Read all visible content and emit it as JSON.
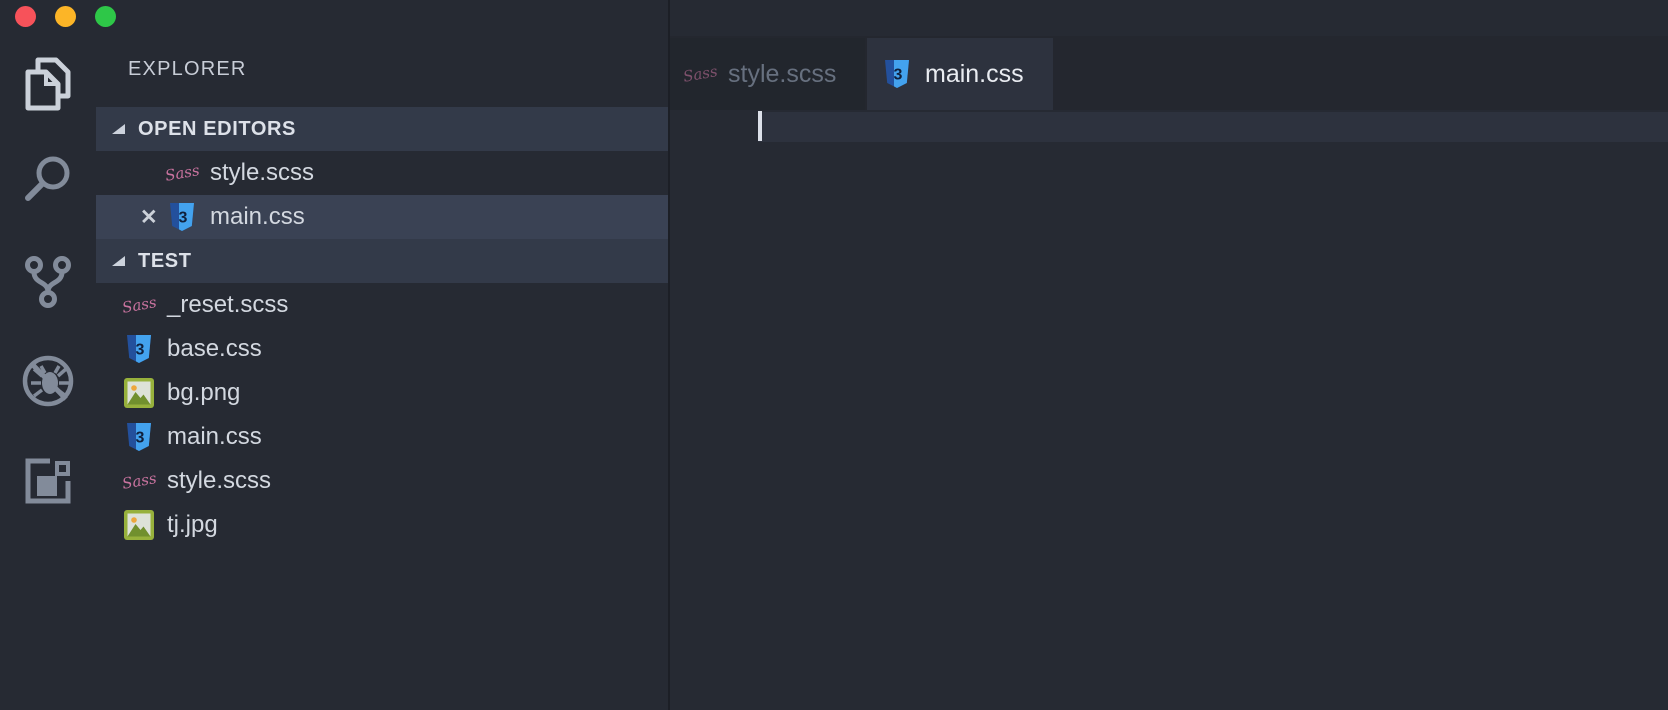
{
  "window": {
    "traffic_lights": [
      {
        "name": "close",
        "color": "#f7525a"
      },
      {
        "name": "minimize",
        "color": "#fcb527"
      },
      {
        "name": "zoom",
        "color": "#2ec748"
      }
    ]
  },
  "activity_bar": {
    "items": [
      {
        "id": "explorer",
        "icon": "files-icon",
        "active": true
      },
      {
        "id": "search",
        "icon": "search-icon",
        "active": false
      },
      {
        "id": "source-control",
        "icon": "git-branch-icon",
        "active": false
      },
      {
        "id": "debug",
        "icon": "debug-disabled-icon",
        "active": false
      },
      {
        "id": "extensions",
        "icon": "extensions-icon",
        "active": false
      }
    ]
  },
  "sidebar": {
    "title": "EXPLORER",
    "sections": [
      {
        "id": "open-editors",
        "header": "OPEN EDITORS",
        "expanded": true
      },
      {
        "id": "test",
        "header": "TEST",
        "expanded": true
      }
    ],
    "open_editors": [
      {
        "name": "style.scss",
        "icon": "sass-icon",
        "selected": false,
        "close_label": ""
      },
      {
        "name": "main.css",
        "icon": "css-icon",
        "selected": true,
        "close_label": "✕"
      }
    ],
    "files": [
      {
        "name": "_reset.scss",
        "icon": "sass-icon"
      },
      {
        "name": "base.css",
        "icon": "css-icon"
      },
      {
        "name": "bg.png",
        "icon": "image-icon"
      },
      {
        "name": "main.css",
        "icon": "css-icon"
      },
      {
        "name": "style.scss",
        "icon": "sass-icon"
      },
      {
        "name": "tj.jpg",
        "icon": "image-icon"
      }
    ]
  },
  "editor": {
    "tabs": [
      {
        "label": "style.scss",
        "icon": "sass-icon",
        "active": false
      },
      {
        "label": "main.css",
        "icon": "css-icon",
        "active": true
      }
    ],
    "content": "",
    "cursor_visible": true
  },
  "colors": {
    "background": "#262a33",
    "section_band": "#333a49",
    "selected_row": "#3a4254",
    "active_tab": "#2d323e",
    "inactive_tab": "#22262d",
    "line_highlight": "#2d323e",
    "sass_pink": "#c9739f",
    "css_blue": "#43a2ee",
    "image_green": "#97b13c"
  }
}
